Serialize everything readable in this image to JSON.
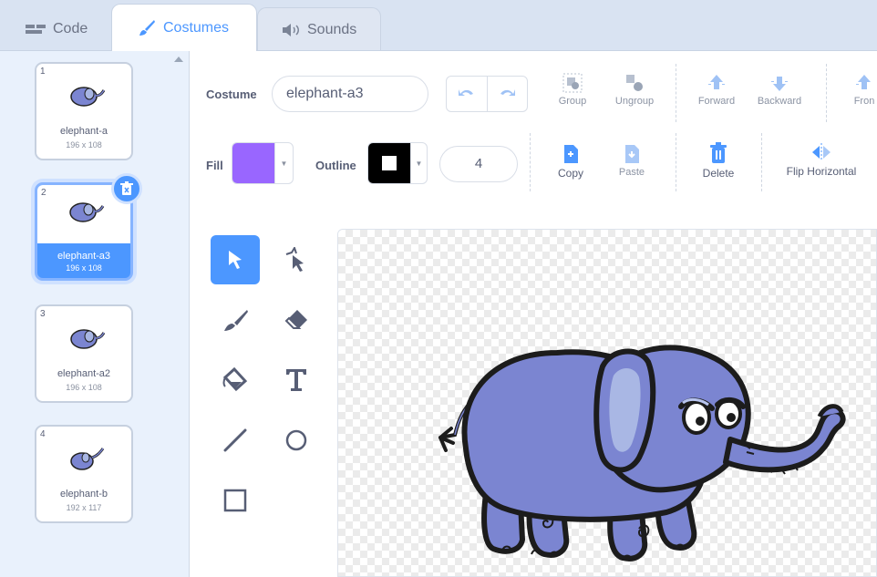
{
  "tabs": {
    "code": "Code",
    "costumes": "Costumes",
    "sounds": "Sounds"
  },
  "costumes": [
    {
      "index": "1",
      "name": "elephant-a",
      "size": "196 x 108"
    },
    {
      "index": "2",
      "name": "elephant-a3",
      "size": "196 x 108"
    },
    {
      "index": "3",
      "name": "elephant-a2",
      "size": "196 x 108"
    },
    {
      "index": "4",
      "name": "elephant-b",
      "size": "192 x 117"
    }
  ],
  "toolbar": {
    "costume_label": "Costume",
    "costume_name": "elephant-a3",
    "fill_label": "Fill",
    "outline_label": "Outline",
    "outline_width": "4",
    "group": "Group",
    "ungroup": "Ungroup",
    "forward": "Forward",
    "backward": "Backward",
    "front": "Fron",
    "copy": "Copy",
    "paste": "Paste",
    "delete": "Delete",
    "flip_horizontal": "Flip Horizontal"
  },
  "colors": {
    "accent": "#4c97ff",
    "fill_color": "#9966ff",
    "outline_color": "#000000",
    "elephant_body": "#7b85d1"
  }
}
